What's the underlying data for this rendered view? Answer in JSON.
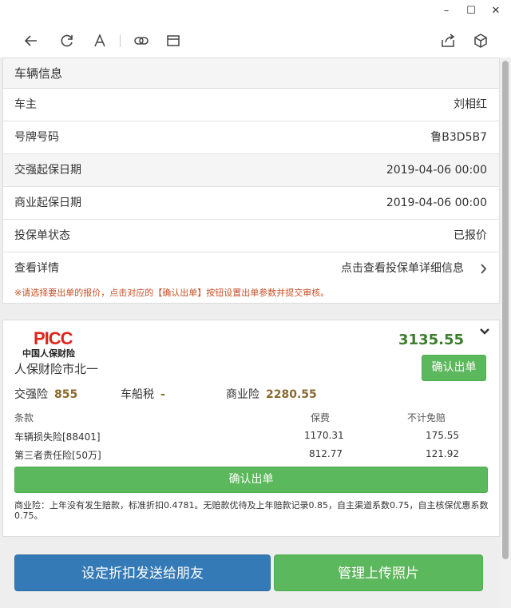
{
  "window": {
    "minimize_glyph": "–",
    "maximize_glyph": "☐",
    "close_glyph": "✕"
  },
  "toolbar": {
    "icons": [
      "back-arrow-icon",
      "refresh-icon",
      "font-size-icon",
      "link-icon",
      "window-icon",
      "share-icon",
      "cube-icon"
    ]
  },
  "vehicle": {
    "title": "车辆信息",
    "rows": [
      {
        "label": "车主",
        "value": "刘相红"
      },
      {
        "label": "号牌号码",
        "value": "鲁B3D5B7"
      },
      {
        "label": "交强起保日期",
        "value": "2019-04-06 00:00"
      },
      {
        "label": "商业起保日期",
        "value": "2019-04-06 00:00"
      },
      {
        "label": "投保单状态",
        "value": "已报价"
      },
      {
        "label": "查看详情",
        "value": "点击查看投保单详细信息"
      }
    ],
    "tip": "※请选择要出单的报价，点击对应的【确认出单】按钮设置出单参数并提交审核。"
  },
  "quote": {
    "logo_text": "PICC",
    "logo_subtext": "中国人保财险",
    "company": "人保财险市北一",
    "total": "3135.55",
    "confirm_label": "确认出单",
    "summary": {
      "jq_label": "交强险",
      "jq_value": "855",
      "ccs_label": "车船税",
      "ccs_value": "-",
      "sy_label": "商业险",
      "sy_value": "2280.55"
    },
    "table": {
      "headers": [
        "条款",
        "保费",
        "不计免赔"
      ],
      "rows": [
        [
          "车辆损失险[88401]",
          "1170.31",
          "175.55"
        ],
        [
          "第三者责任险[50万]",
          "812.77",
          "121.92"
        ]
      ]
    },
    "confirm_wide_label": "确认出单",
    "note": "商业险：上年没有发生赔款，标准折扣0.4781。无赔款优待及上年赔款记录0.85，自主渠道系数0.75，自主核保优惠系数0.75。"
  },
  "actions": {
    "discount_label": "设定折扣发送给朋友",
    "photos_label": "管理上传照片"
  },
  "colors": {
    "primary": "#337ab7",
    "success": "#5cb85c",
    "price": "#3d7d2e",
    "tip": "#c8512a",
    "picc_red": "#e0251b"
  }
}
